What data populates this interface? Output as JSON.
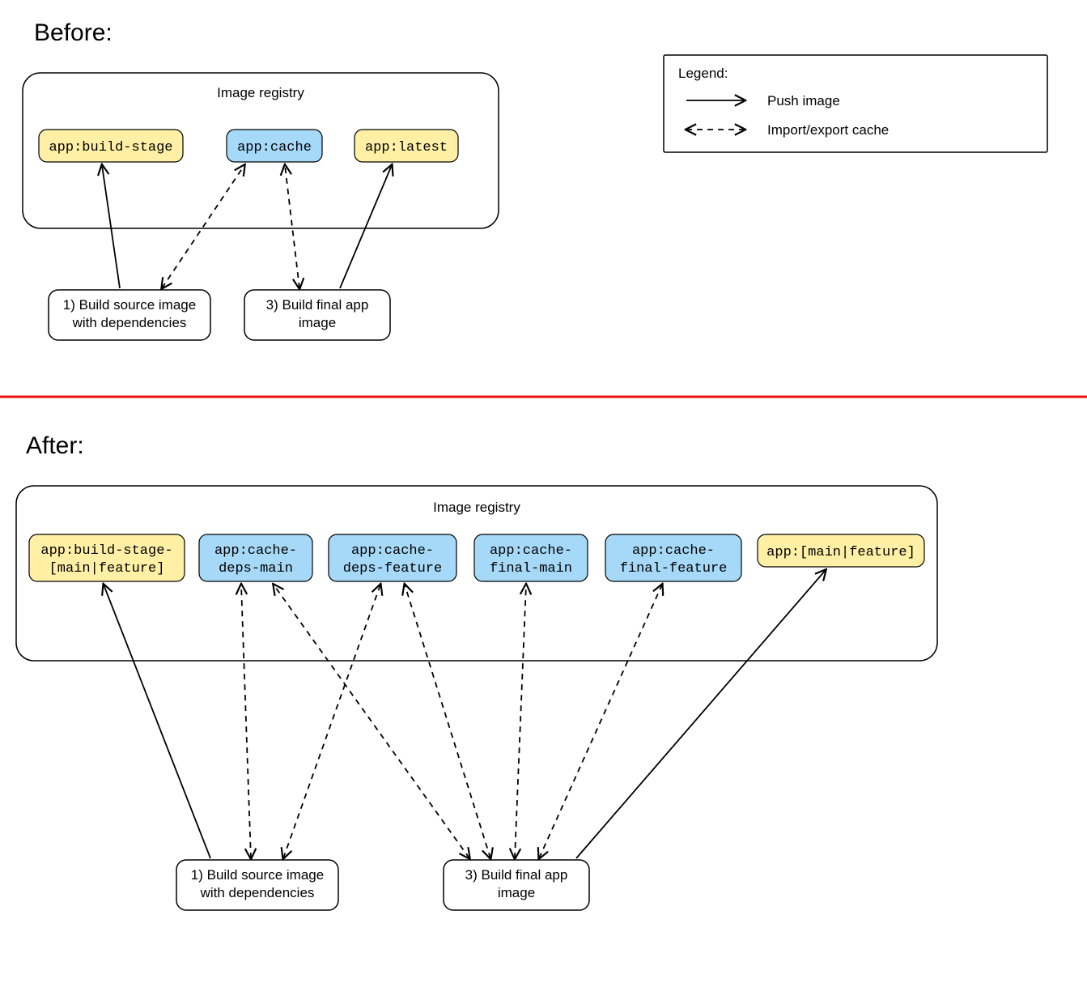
{
  "headings": {
    "before": "Before:",
    "after": "After:"
  },
  "legend": {
    "title": "Legend:",
    "push": "Push image",
    "cache": "Import/export cache"
  },
  "before": {
    "registry_title": "Image registry",
    "tags": {
      "build_stage": "app:build-stage",
      "cache": "app:cache",
      "latest": "app:latest"
    },
    "steps": {
      "step1_l1": "1) Build source image",
      "step1_l2": "with dependencies",
      "step3_l1": "3) Build final app",
      "step3_l2": "image"
    }
  },
  "after": {
    "registry_title": "Image registry",
    "tags": {
      "build_stage_l1": "app:build-stage-",
      "build_stage_l2": "[main|feature]",
      "cache_deps_main_l1": "app:cache-",
      "cache_deps_main_l2": "deps-main",
      "cache_deps_feat_l1": "app:cache-",
      "cache_deps_feat_l2": "deps-feature",
      "cache_final_main_l1": "app:cache-",
      "cache_final_main_l2": "final-main",
      "cache_final_feat_l1": "app:cache-",
      "cache_final_feat_l2": "final-feature",
      "main_feature": "app:[main|feature]"
    },
    "steps": {
      "step1_l1": "1) Build source image",
      "step1_l2": "with dependencies",
      "step3_l1": "3) Build final app",
      "step3_l2": "image"
    }
  }
}
